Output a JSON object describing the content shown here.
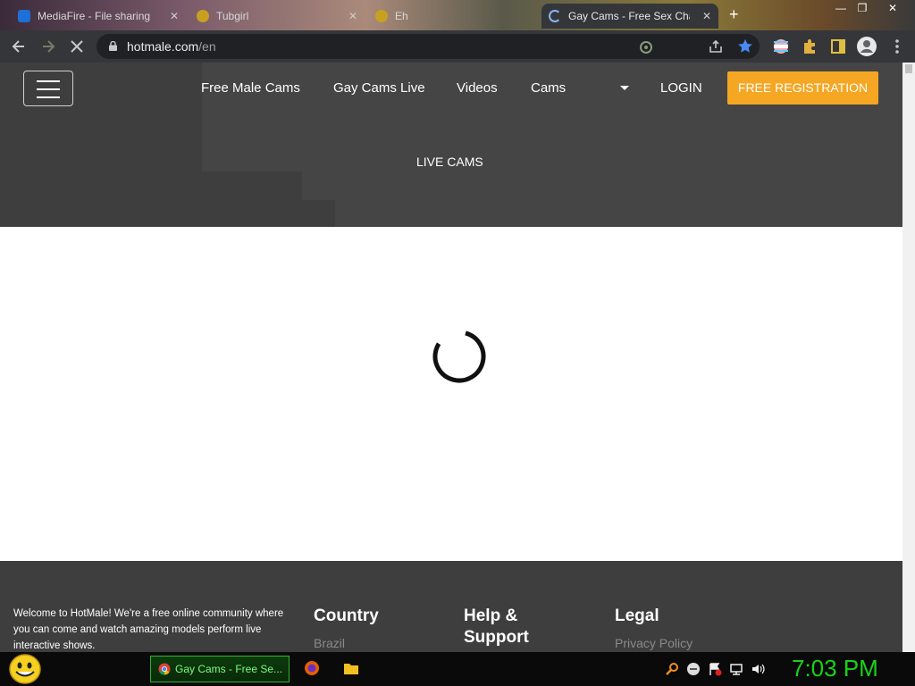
{
  "browser": {
    "tabs": [
      {
        "title": "MediaFire - File sharing",
        "active": false
      },
      {
        "title": "Tubgirl",
        "active": false
      },
      {
        "title": "Eh",
        "active": false
      },
      {
        "title": "Gay Cams - Free Sex Cha",
        "active": true
      }
    ],
    "new_tab_label": "+",
    "url_host": "hotmale.com",
    "url_path": "/en"
  },
  "site": {
    "nav": [
      "Free Male Cams",
      "Gay Cams Live",
      "Videos",
      "Cams"
    ],
    "login": "LOGIN",
    "register": "FREE REGISTRATION",
    "hero_title": "LIVE CAMS",
    "accent_color": "#f5a623"
  },
  "footer": {
    "welcome": "Welcome to HotMale! We're a free online community where you can come and watch amazing models perform live interactive shows.",
    "columns": [
      {
        "heading": "Country",
        "first_link": "Brazil"
      },
      {
        "heading": "Help & Support",
        "first_link": ""
      },
      {
        "heading": "Legal",
        "first_link": "Privacy Policy"
      }
    ]
  },
  "taskbar": {
    "task_label": "Gay Cams - Free Se...",
    "clock": "7:03 PM"
  }
}
